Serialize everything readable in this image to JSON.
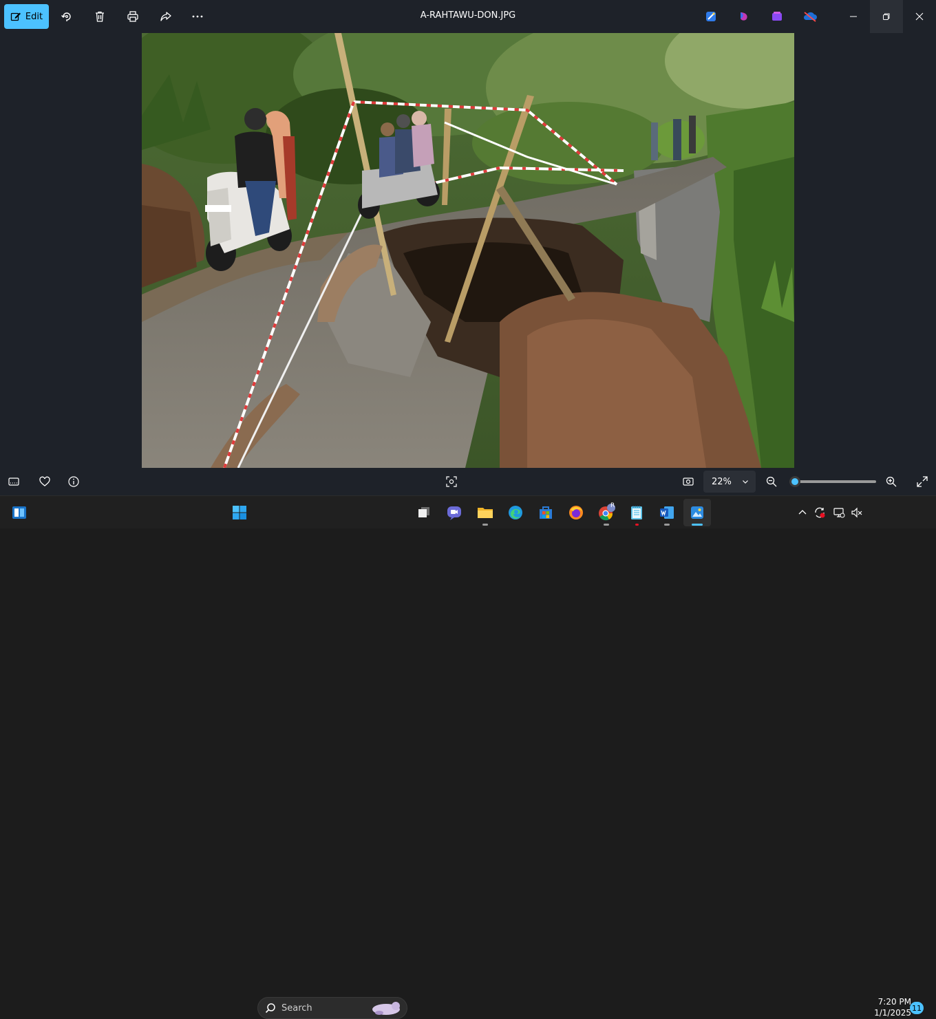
{
  "titlebar": {
    "edit_label": "Edit",
    "file_title": "A-RAHTAWU-DON.JPG",
    "icons": [
      "rotate-icon",
      "delete-icon",
      "print-icon",
      "share-icon",
      "more-icon"
    ],
    "app_icons": [
      "designer-icon",
      "clipchamp-icon",
      "generative-icon",
      "onedrive-icon"
    ]
  },
  "bottombar": {
    "zoom_value": "22%",
    "zoom_fraction": 0.0
  },
  "taskbar": {
    "search_placeholder": "Search",
    "time": "7:20 PM",
    "date": "1/1/2025",
    "notification_count": "11",
    "chrome_profile": "R"
  },
  "colors": {
    "accent": "#4cc2ff",
    "app_background": "#1e2229",
    "taskbar": "#202020"
  }
}
